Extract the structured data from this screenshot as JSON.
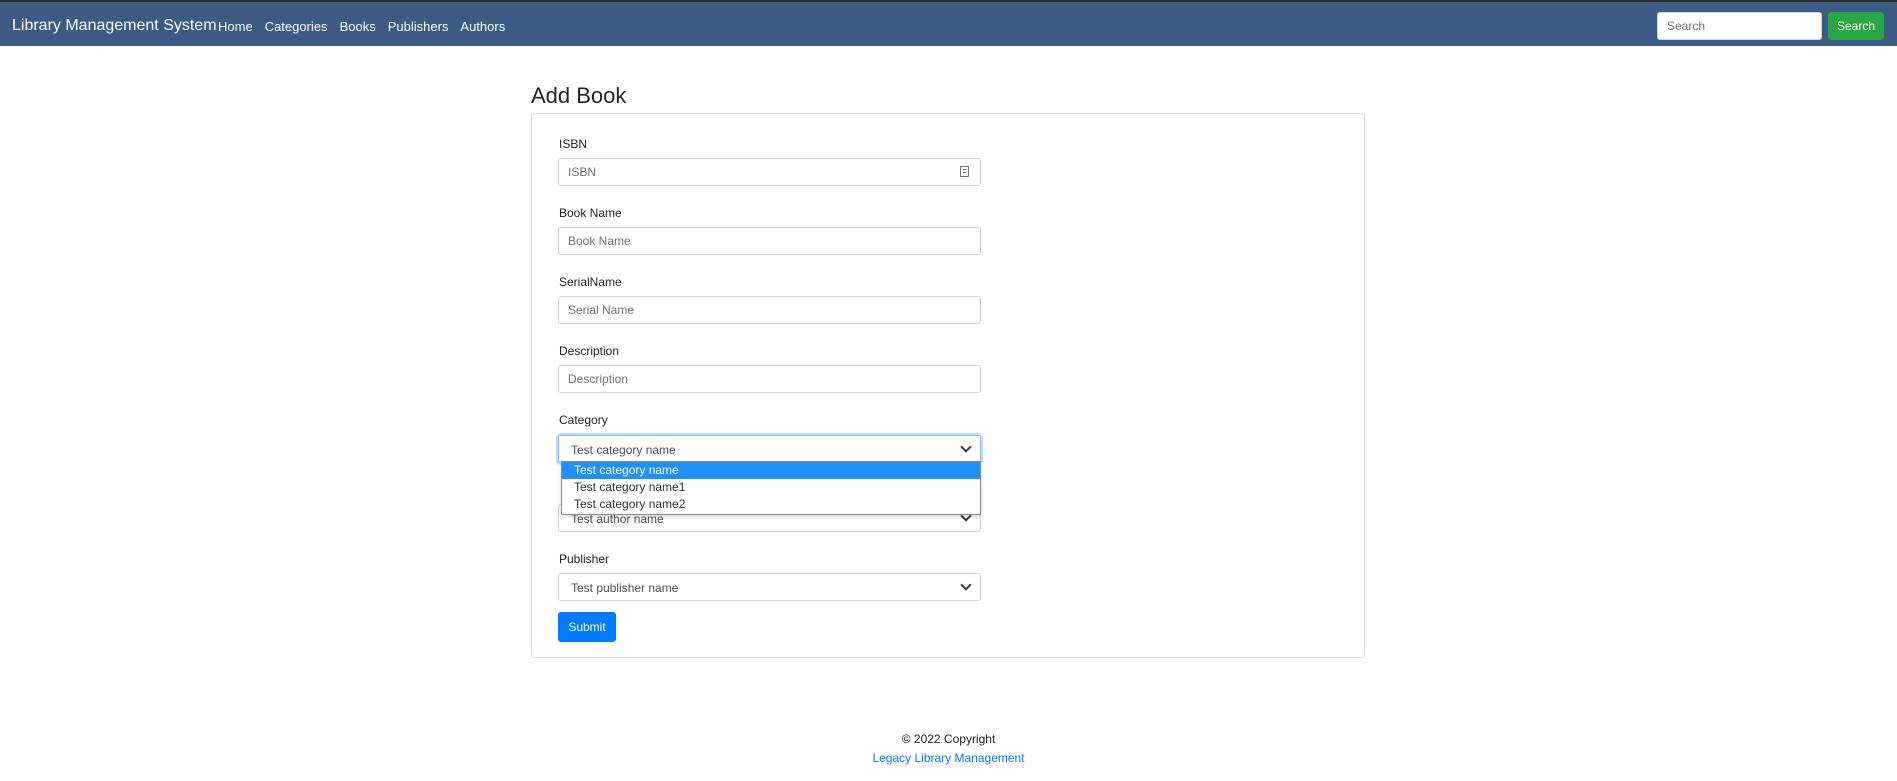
{
  "navbar": {
    "brand": "Library Management System",
    "links": [
      "Home",
      "Categories",
      "Books",
      "Publishers",
      "Authors"
    ],
    "search_placeholder": "Search",
    "search_button": "Search",
    "bg_color": "#3b5b85",
    "search_button_color": "#28a745"
  },
  "page": {
    "title": "Add Book"
  },
  "form": {
    "isbn": {
      "label": "ISBN",
      "placeholder": "ISBN",
      "icon": "id-card-icon"
    },
    "book_name": {
      "label": "Book Name",
      "placeholder": "Book Name"
    },
    "serial_name": {
      "label": "SerialName",
      "placeholder": "Serial Name"
    },
    "description": {
      "label": "Description",
      "placeholder": "Description"
    },
    "category": {
      "label": "Category",
      "value": "Test category name",
      "options": [
        "Test category name",
        "Test category name1",
        "Test category name2"
      ],
      "selected_index": 0
    },
    "author": {
      "value": "Test author name"
    },
    "publisher": {
      "label": "Publisher",
      "value": "Test publisher name"
    },
    "submit": "Submit",
    "submit_color": "#007bff"
  },
  "footer": {
    "copyright": "© 2022 Copyright",
    "link": "Legacy Library Management"
  }
}
